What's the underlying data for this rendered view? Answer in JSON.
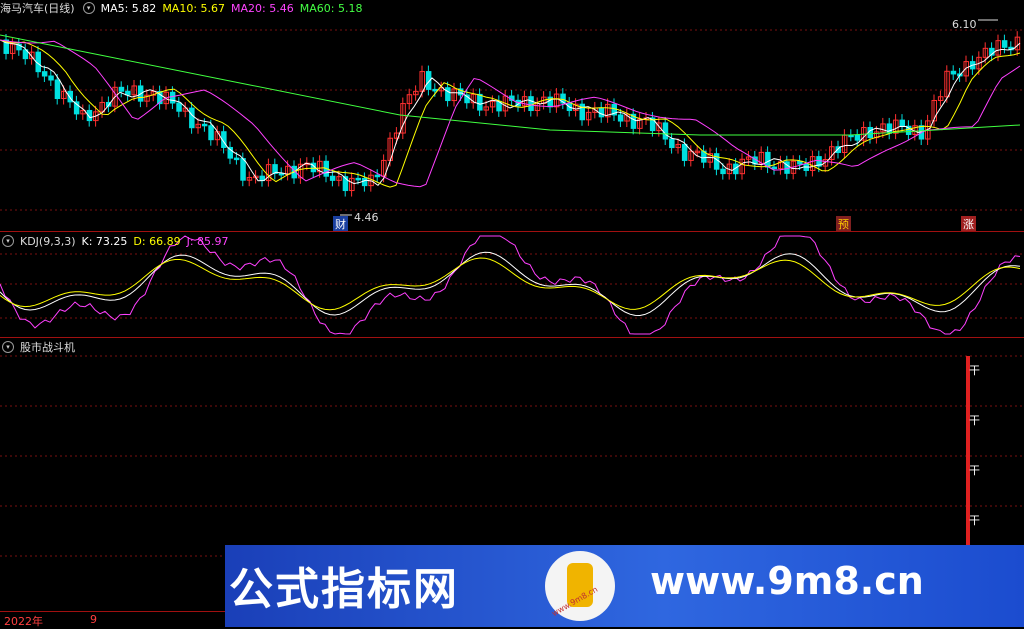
{
  "main": {
    "title": "海马汽车(日线)",
    "ma": [
      {
        "label": "MA5: 5.82",
        "color": "#ffffff"
      },
      {
        "label": "MA10: 5.67",
        "color": "#ffff00"
      },
      {
        "label": "MA20: 5.46",
        "color": "#ff40ff"
      },
      {
        "label": "MA60: 5.18",
        "color": "#40ff40"
      }
    ],
    "high_label": "6.10",
    "low_label": "4.46",
    "markers": [
      {
        "text": "财",
        "color": "#ffffff",
        "bg": "#1a3fa0"
      },
      {
        "text": "预",
        "color": "#ffcc00",
        "bg": "#802020"
      },
      {
        "text": "涨",
        "color": "#ffffff",
        "bg": "#a02020"
      }
    ]
  },
  "kdj": {
    "title": "KDJ(9,3,3)",
    "k": "K: 73.25",
    "d": "D: 66.89",
    "j": "J: 85.97",
    "k_color": "#ffffff",
    "d_color": "#ffff00",
    "j_color": "#ff40ff"
  },
  "indicator": {
    "title": "股市战斗机",
    "signal_symbol": "干"
  },
  "axis": {
    "year": "2022年",
    "month": "9"
  },
  "banner": {
    "left_text": "公式指标网",
    "right_text": "www.9m8.cn",
    "logo_text": "www.9m8.cn"
  },
  "colors": {
    "up": "#ff3030",
    "down": "#00e0e0",
    "grid": "#7a1010",
    "divider": "#a01010"
  }
}
